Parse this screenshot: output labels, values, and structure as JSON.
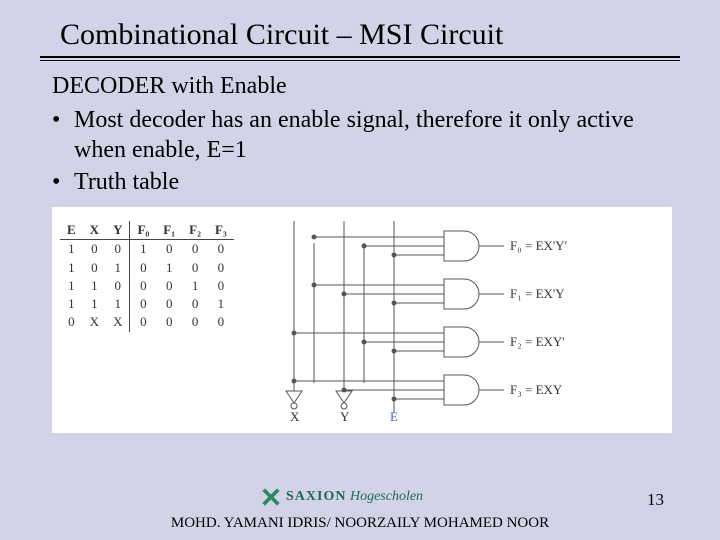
{
  "title": "Combinational Circuit – MSI Circuit",
  "subhead": "DECODER with Enable",
  "bullets": [
    "Most decoder has an enable signal, therefore it only active when enable, E=1",
    "Truth table"
  ],
  "truth_table": {
    "headers_in": [
      "E",
      "X",
      "Y"
    ],
    "headers_out": [
      "F₀",
      "F₁",
      "F₂",
      "F₃"
    ],
    "rows": [
      [
        "1",
        "0",
        "0",
        "1",
        "0",
        "0",
        "0"
      ],
      [
        "1",
        "0",
        "1",
        "0",
        "1",
        "0",
        "0"
      ],
      [
        "1",
        "1",
        "0",
        "0",
        "0",
        "1",
        "0"
      ],
      [
        "1",
        "1",
        "1",
        "0",
        "0",
        "0",
        "1"
      ],
      [
        "0",
        "X",
        "X",
        "0",
        "0",
        "0",
        "0"
      ]
    ]
  },
  "circuit": {
    "outputs": [
      {
        "name": "F₀",
        "expr": "= EX'Y'"
      },
      {
        "name": "F₁",
        "expr": "= EX'Y"
      },
      {
        "name": "F₂",
        "expr": "= EXY'"
      },
      {
        "name": "F₃",
        "expr": "= EXY"
      }
    ],
    "inputs": [
      "X",
      "Y",
      "E"
    ]
  },
  "logo": {
    "brand": "SAXION",
    "sub": "Hogescholen"
  },
  "footer": "MOHD. YAMANI IDRIS/ NOORZAILY MOHAMED NOOR",
  "page_number": "13"
}
